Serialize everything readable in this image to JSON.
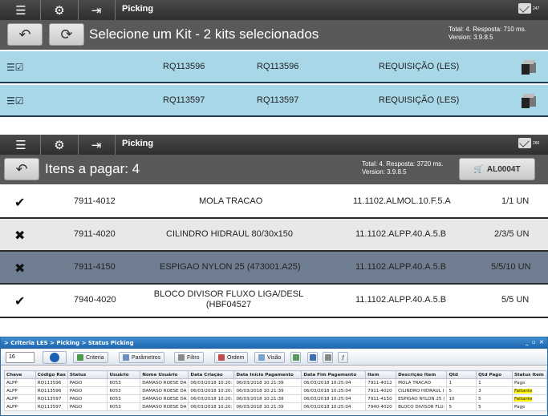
{
  "panel1": {
    "topbar": {
      "title": "Picking",
      "mail_count": "247",
      "icons": [
        "menu-icon",
        "settings-gear-icon",
        "logout-icon",
        "mail-icon"
      ]
    },
    "heading": "Selecione um Kit - 2 kits selecionados",
    "stats_line1": "Total: 4. Resposta: 710 ms.",
    "stats_line2": "Version: 3.9.8.5",
    "buttons": {
      "back_icon": "undo-arrow-icon",
      "refresh_icon": "refresh-icon"
    },
    "kits": [
      {
        "req1": "RQ113596",
        "req2": "RQ113596",
        "type": "REQUISIÇÃO (LES)"
      },
      {
        "req1": "RQ113597",
        "req2": "RQ113597",
        "type": "REQUISIÇÃO (LES)"
      }
    ]
  },
  "panel2": {
    "topbar": {
      "title": "Picking",
      "mail_count": "260"
    },
    "heading": "Itens a pagar: 4",
    "stats_line1": "Total: 4. Resposta: 3720 ms.",
    "stats_line2": "Version: 3.9.8.5",
    "cart_label": "AL0004T",
    "items": [
      {
        "status": "✔",
        "status_icon": "double-check-icon",
        "code": "7911-4012",
        "desc": "MOLA TRACAO",
        "loc": "11.1102.ALMOL.10.F.5.A",
        "qty": "1/1 UN"
      },
      {
        "status": "✖",
        "status_icon": "x-icon",
        "code": "7911-4020",
        "desc": "CILINDRO HIDRAUL 80/30x150",
        "loc": "11.1102.ALPP.40.A.5.B",
        "qty": "2/3/5 UN"
      },
      {
        "status": "✖",
        "status_icon": "x-icon",
        "code": "7911-4150",
        "desc": "ESPIGAO NYLON 25 (473001.A25)",
        "loc": "11.1102.ALPP.40.A.5.B",
        "qty": "5/5/10 UN"
      },
      {
        "status": "✔",
        "status_icon": "double-check-icon",
        "code": "7940-4020",
        "desc": "BLOCO DIVISOR FLUXO LIGA/DESL (HBF04527",
        "loc": "11.1102.ALPP.40.A.5.B",
        "qty": "5/5 UN"
      }
    ]
  },
  "panel3": {
    "title": "> Criteria LES > Picking > Status Picking",
    "spin_value": "16",
    "toolbar": {
      "criteria": "Criteria",
      "parametros": "Parâmetros",
      "filtro": "Filtro",
      "ordem": "Ordem",
      "visao": "Visão"
    },
    "columns": [
      "Chave",
      "Código Ras",
      "Status",
      "Usuário",
      "Nome Usuário",
      "Data Criação",
      "Data Início Pagamento",
      "Data Fim Pagamento",
      "Item",
      "Descrição Item",
      "Qtd",
      "Qtd Pago",
      "Status Item"
    ],
    "rows": [
      [
        "ALPP",
        "RQ113596",
        "PAGO",
        "6053",
        "DAMASO ROESE DA",
        "06/03/2018 10:20:",
        "06/03/2018 10:21:39",
        "06/03/2018 10:25:04",
        "7911-4012",
        "MOLA TRACAO",
        "1",
        "1",
        "Pago"
      ],
      [
        "ALPP",
        "RQ113596",
        "PAGO",
        "6053",
        "DAMASO ROESE DA",
        "06/03/2018 10:20:",
        "06/03/2018 10:21:39",
        "06/03/2018 10:25:04",
        "7911-4020",
        "CILINDRO HIDRAUL I",
        "5",
        "3",
        "Faltante"
      ],
      [
        "ALPP",
        "RQ113597",
        "PAGO",
        "6053",
        "DAMASO ROESE DA",
        "06/03/2018 10:20:",
        "06/03/2018 10:21:39",
        "06/03/2018 10:25:04",
        "7911-4150",
        "ESPIGAO NYLON 25 (",
        "10",
        "5",
        "Faltante"
      ],
      [
        "ALPP",
        "RQ113597",
        "PAGO",
        "6053",
        "DAMASO ROESE DA",
        "06/03/2018 10:20:",
        "06/03/2018 10:21:39",
        "06/03/2018 10:25:04",
        "7940-4020",
        "BLOCO DIVISOR FLU:",
        "5",
        "5",
        "Pago"
      ]
    ]
  }
}
